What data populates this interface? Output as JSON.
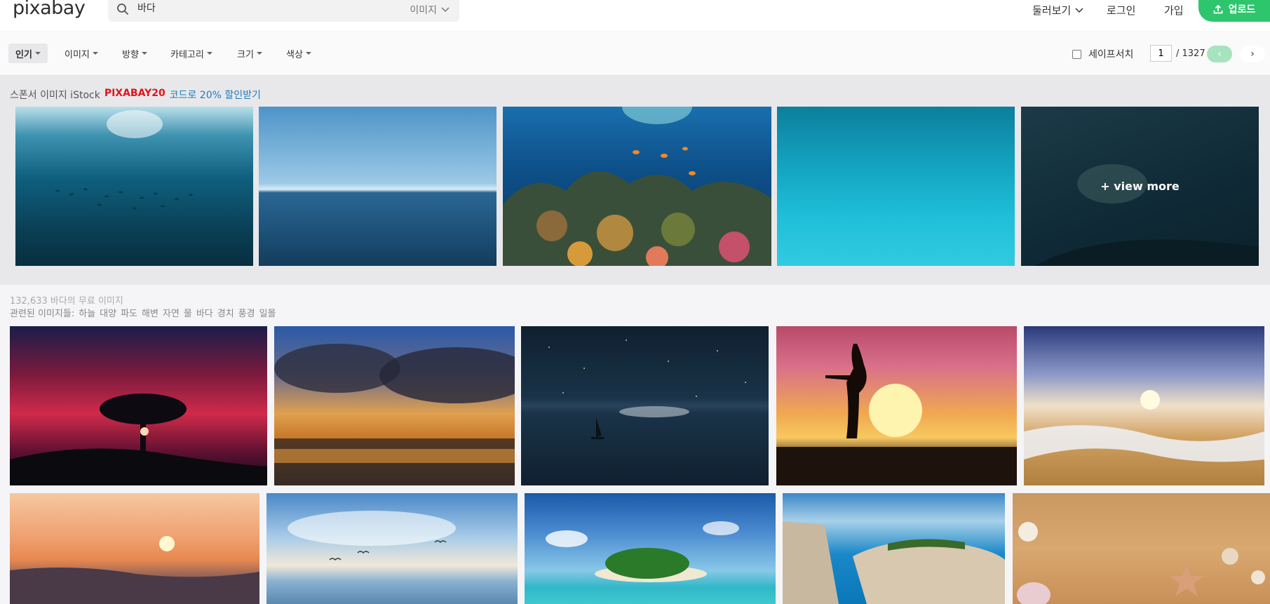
{
  "header": {
    "logo": "pixabay",
    "search_value": "바다",
    "search_type": "이미지",
    "explore": "둘러보기",
    "login": "로그인",
    "join": "가입",
    "upload": "업로드"
  },
  "filters": {
    "items": [
      "인기",
      "이미지",
      "방향",
      "카테고리",
      "크기",
      "색상"
    ],
    "safesearch": "세이프서치",
    "page_value": "1",
    "page_total": "/ 1327",
    "prev_glyph": "‹",
    "next_glyph": "›"
  },
  "sponsor": {
    "prefix": "스폰서 이미지 iStock",
    "code": "PIXABAY20",
    "deal": "코드로 20% 할인받기",
    "view_more": "+ view more"
  },
  "results": {
    "count_text": "132,633 바다의 무료 이미지",
    "related_label": "관련된 이미지들:",
    "related_tags": [
      "하늘",
      "대양",
      "파도",
      "해변",
      "자연",
      "물",
      "바다",
      "경치",
      "풍경",
      "일몰"
    ]
  },
  "colors": {
    "accent": "#2ec66d",
    "promo_red": "#e3141a",
    "promo_blue": "#1f7bc0"
  }
}
